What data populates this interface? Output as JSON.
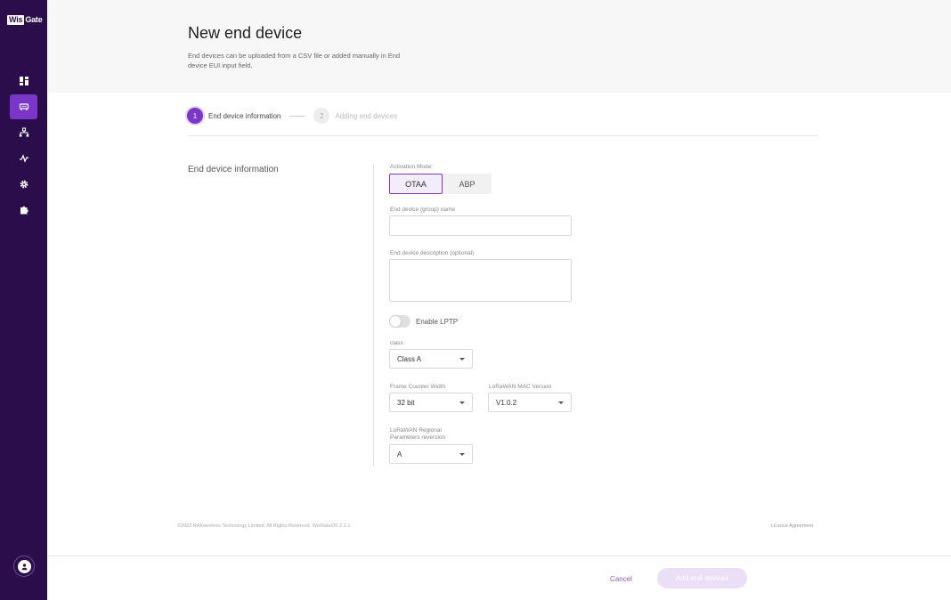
{
  "app": {
    "logo_prefix": "Wis",
    "logo_suffix": "Gate"
  },
  "header": {
    "title": "New end device",
    "description": "End devices can be uploaded from a CSV file or added manually in End device EUI input field."
  },
  "stepper": {
    "steps": [
      {
        "number": "1",
        "label": "End device information"
      },
      {
        "number": "2",
        "label": "Adding end devices"
      }
    ]
  },
  "form": {
    "section_title": "End device information",
    "activation_mode": {
      "label": "Activation Mode",
      "options": [
        "OTAA",
        "ABP"
      ],
      "selected": "OTAA"
    },
    "name": {
      "label": "End device (group) name",
      "value": ""
    },
    "description": {
      "label": "End device description (optional)",
      "value": ""
    },
    "lptp": {
      "label": "Enable LPTP",
      "enabled": false
    },
    "class": {
      "label": "class",
      "value": "Class A"
    },
    "frame_counter": {
      "label": "Frame Counter Width",
      "value": "32 bit"
    },
    "mac_version": {
      "label": "LoRaWAN MAC Version",
      "value": "V1.0.2"
    },
    "regional": {
      "label_line1": "LoRaWAN Regional",
      "label_line2": "Parameters reversion",
      "value": "A"
    }
  },
  "footer": {
    "copyright": "©2022 RAKwireless Technology Limited. All Rights Reserved. WisGateOS 2.1.1",
    "license": "Licence Agreement"
  },
  "actions": {
    "cancel": "Cancel",
    "submit": "Add end devices"
  },
  "colors": {
    "sidebar": "#2a0d4a",
    "accent": "#7a36c9"
  }
}
